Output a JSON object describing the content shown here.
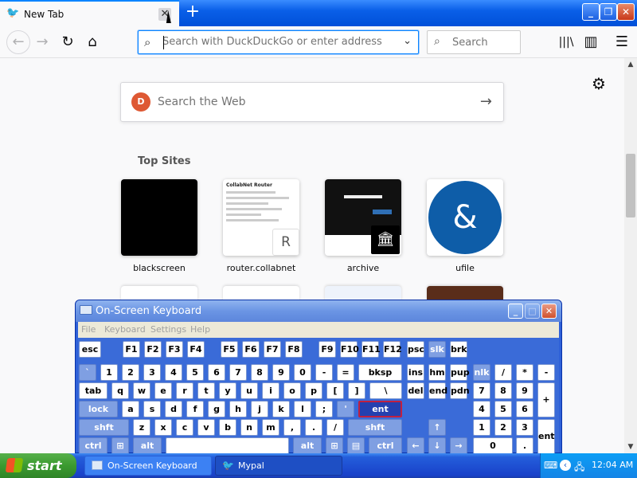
{
  "browser": {
    "tab_title": "New Tab",
    "tab_close_glyph": "✕",
    "new_tab_glyph": "+",
    "window_buttons": {
      "minimize": "_",
      "restore": "❐",
      "close": "✕"
    },
    "nav": {
      "back": "←",
      "forward": "→",
      "reload": "↻",
      "home": "⌂"
    },
    "url_placeholder": "Search with DuckDuckGo or enter address",
    "url_value": "",
    "url_dropdown": "⌄",
    "search_placeholder": "Search",
    "toolbar": {
      "library": "|||\\",
      "sidebar": "▥",
      "menu": "☰"
    }
  },
  "newtab": {
    "settings_glyph": "⚙",
    "web_search_placeholder": "Search the Web",
    "web_search_go": "→",
    "ddg_logo": "D",
    "top_sites_heading": "Top Sites",
    "sites": [
      {
        "name": "blackscreen"
      },
      {
        "name": "router.collabnet",
        "badge": "R",
        "doc_title": "CollabNet Router"
      },
      {
        "name": "archive",
        "badge": "🏛"
      },
      {
        "name": "ufile",
        "logo": "&"
      }
    ]
  },
  "osk": {
    "title": "On-Screen Keyboard",
    "menu": [
      "File",
      "Keyboard",
      "Settings",
      "Help"
    ],
    "buttons": {
      "minimize": "_",
      "maximize": "□",
      "close": "✕"
    },
    "rows": {
      "fn": [
        "esc",
        "F1",
        "F2",
        "F3",
        "F4",
        "F5",
        "F6",
        "F7",
        "F8",
        "F9",
        "F10",
        "F11",
        "F12",
        "psc",
        "slk",
        "brk"
      ],
      "num": [
        "`",
        "1",
        "2",
        "3",
        "4",
        "5",
        "6",
        "7",
        "8",
        "9",
        "0",
        "-",
        "=",
        "bksp",
        "ins",
        "hm",
        "pup",
        "nlk",
        "/",
        "*",
        "-"
      ],
      "top": [
        "tab",
        "q",
        "w",
        "e",
        "r",
        "t",
        "y",
        "u",
        "i",
        "o",
        "p",
        "[",
        "]",
        "\\",
        "del",
        "end",
        "pdn",
        "7",
        "8",
        "9",
        "+"
      ],
      "home": [
        "lock",
        "a",
        "s",
        "d",
        "f",
        "g",
        "h",
        "j",
        "k",
        "l",
        ";",
        "'",
        "ent",
        "4",
        "5",
        "6"
      ],
      "bottom": [
        "shft",
        "z",
        "x",
        "c",
        "v",
        "b",
        "n",
        "m",
        ",",
        ".",
        "/",
        "shft",
        "↑",
        "1",
        "2",
        "3",
        "ent"
      ],
      "space": [
        "ctrl",
        "⊞",
        "alt",
        "",
        "alt",
        "⊞",
        "▤",
        "ctrl",
        "←",
        "↓",
        "→",
        "0",
        "."
      ]
    }
  },
  "taskbar": {
    "start": "start",
    "buttons": [
      {
        "label": "On-Screen Keyboard"
      },
      {
        "label": "Mypal"
      }
    ],
    "clock": "12:04 AM",
    "tray_icons": [
      "⌨",
      "‹",
      "🖧"
    ]
  }
}
